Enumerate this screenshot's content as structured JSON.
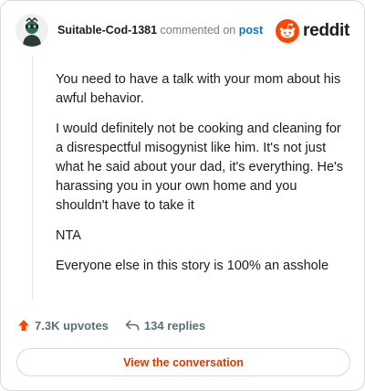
{
  "comment": {
    "username": "Suitable-Cod-1381",
    "action_text": "commented on",
    "post_link": "post",
    "paragraphs": [
      "You need to have a talk with your mom about his awful behavior.",
      "I would definitely not be cooking and cleaning for a disrespectful misogynist like him. It's not just what he said about your dad, it's everything. He's harassing you in your own home and you shouldn't have to take it",
      "NTA",
      "Everyone else in this story is 100% an asshole"
    ]
  },
  "brand": {
    "wordmark": "reddit",
    "icon": "reddit-alien-icon",
    "color": "#ff4500"
  },
  "actions": {
    "upvotes": "7.3K upvotes",
    "replies": "134 replies",
    "upvote_icon": "upvote-arrow-icon",
    "reply_icon": "reply-arrow-icon",
    "upvote_color": "#ff4500"
  },
  "cta": {
    "label": "View the conversation",
    "color": "#d93a00"
  }
}
